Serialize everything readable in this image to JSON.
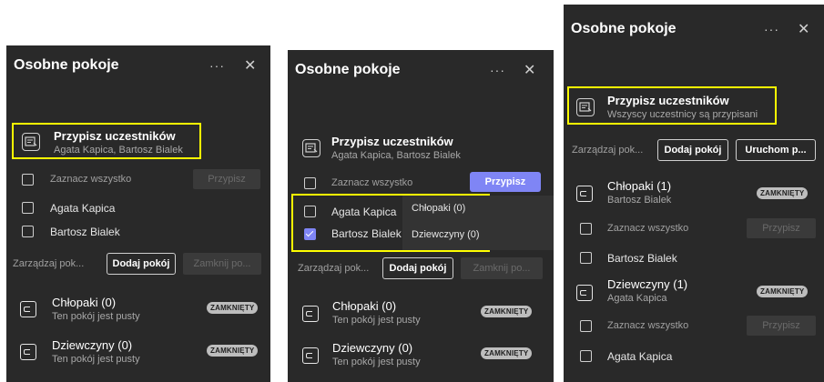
{
  "common": {
    "title": "Osobne pokoje",
    "more": "···",
    "close": "✕",
    "assign_title": "Przypisz uczestników",
    "assign_subtitle": "Agata Kapica, Bartosz Bialek",
    "assign_subtitle_all": "Wszyscy uczestnicy są przypisani",
    "select_all": "Zaznacz wszystko",
    "assign_button": "Przypisz",
    "manage_label": "Zarządzaj pok...",
    "manage_label_long": "Zarządzaj pok...",
    "add_room_button": "Dodaj pokój",
    "close_rooms_button": "Zamknij po...",
    "start_rooms_button": "Uruchom p...",
    "status_closed": "ZAMKNIĘTY",
    "empty_room": "Ten pokój jest pusty"
  },
  "participants": [
    "Agata Kapica",
    "Bartosz Bialek"
  ],
  "rooms_panel1": [
    {
      "name": "Chłopaki (0)",
      "subtitle": "Ten pokój jest pusty"
    },
    {
      "name": "Dziewczyny (0)",
      "subtitle": "Ten pokój jest pusty"
    }
  ],
  "dropdown_options": [
    "Chłopaki (0)",
    "Dziewczyny (0)"
  ],
  "panel2_checks": {
    "agata": false,
    "bartosz": true
  },
  "rooms_panel3": [
    {
      "name": "Chłopaki (1)",
      "subtitle": "Bartosz Bialek",
      "member": "Bartosz Bialek"
    },
    {
      "name": "Dziewczyny (1)",
      "subtitle": "Agata Kapica",
      "member": "Agata Kapica"
    }
  ],
  "colors": {
    "panel_bg": "#292929",
    "accent": "#7f85f5",
    "highlight": "#ffff00"
  }
}
